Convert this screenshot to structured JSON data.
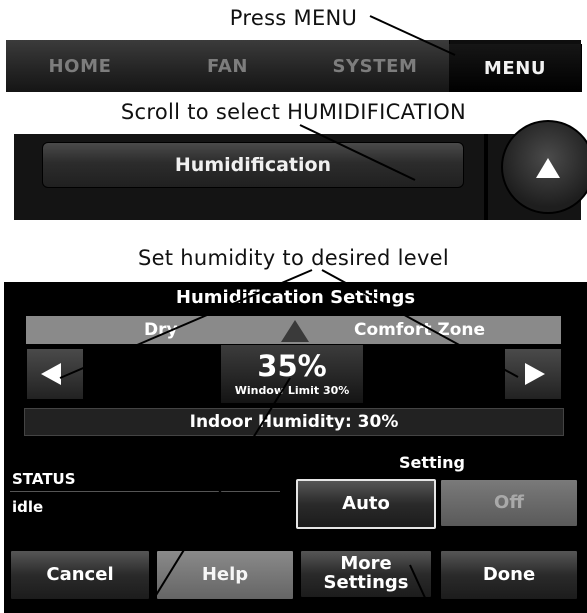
{
  "captions": {
    "step1": "Press MENU",
    "step2": "Scroll to select HUMIDIFICATION",
    "step3": "Set humidity to desired level"
  },
  "tabs": [
    {
      "label": "HOME",
      "active": false
    },
    {
      "label": "FAN",
      "active": false
    },
    {
      "label": "SYSTEM",
      "active": false
    },
    {
      "label": "MENU",
      "active": true
    }
  ],
  "menu_list": {
    "selected_item": "Humidification",
    "scroll_up_icon": "up-arrow-icon"
  },
  "humidification_screen": {
    "title": "Humidification Settings",
    "scale_left_label": "Dry",
    "scale_right_label": "Comfort Zone",
    "setpoint": "35%",
    "window_limit": "Window Limit 30%",
    "indoor_humidity": "Indoor Humidity: 30%",
    "status_label": "STATUS",
    "status_value": "idle",
    "setting_label": "Setting",
    "auto_label": "Auto",
    "off_label": "Off",
    "cancel_label": "Cancel",
    "help_label": "Help",
    "more_settings_label": "More Settings",
    "done_label": "Done",
    "decrease_icon": "left-arrow-icon",
    "increase_icon": "right-arrow-icon"
  },
  "colors": {
    "screen_bg": "#000000",
    "band": "#8a8a8a",
    "text": "#ffffff"
  }
}
